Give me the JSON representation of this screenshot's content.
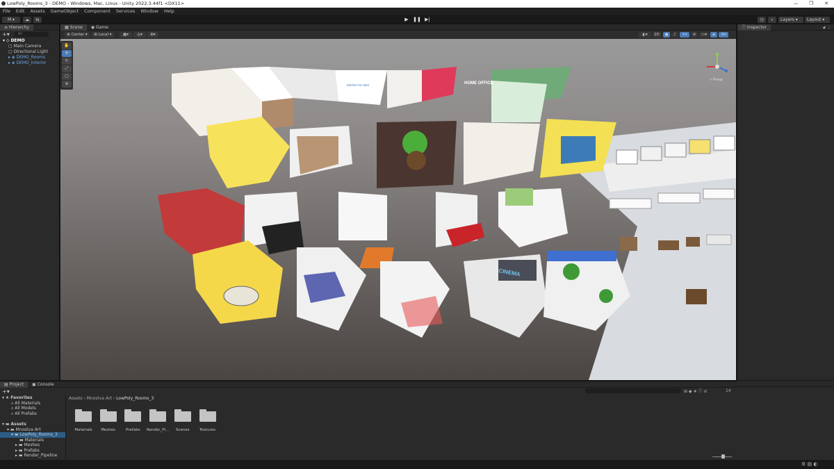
{
  "window": {
    "title": "LowPoly_Rooms_3 - DEMO - Windows, Mac, Linux - Unity 2022.3.44f1 <DX11>",
    "minimize": "—",
    "maximize": "❐",
    "close": "✕"
  },
  "menu": [
    "File",
    "Edit",
    "Assets",
    "GameObject",
    "Component",
    "Services",
    "Window",
    "Help"
  ],
  "toolbar": {
    "account": "M ▾",
    "layers": "Layers",
    "layout": "Layout"
  },
  "hierarchy": {
    "tab": "Hierarchy",
    "search_placeholder": "All",
    "items": [
      {
        "label": "DEMO",
        "indent": 0,
        "color": "#ffffff"
      },
      {
        "label": "Main Camera",
        "indent": 1,
        "color": "#c8c8c8"
      },
      {
        "label": "Directional Light",
        "indent": 1,
        "color": "#c8c8c8"
      },
      {
        "label": "DEMO_Rooms",
        "indent": 1,
        "color": "#6fa8e8"
      },
      {
        "label": "DEMO_Interior",
        "indent": 1,
        "color": "#6fa8e8"
      }
    ]
  },
  "scene": {
    "tabs": [
      "Scene",
      "Game"
    ],
    "pivot": "Center",
    "space": "Local",
    "mode_2d": "2D",
    "persp_label": "< Persp"
  },
  "inspector": {
    "tab": "Inspector"
  },
  "project": {
    "tabs": [
      "Project",
      "Console"
    ],
    "breadcrumb": [
      "Assets",
      "Mnostva Art",
      "LowPoly_Rooms_3"
    ],
    "count": "14",
    "favorites": {
      "label": "Favorites",
      "items": [
        "All Materials",
        "All Models",
        "All Prefabs"
      ]
    },
    "assets": {
      "label": "Assets",
      "children": [
        "Mnostva Art",
        "LowPoly_Rooms_3",
        "Materials",
        "Meshes",
        "Prefabs",
        "Render_Pipeline"
      ]
    },
    "folders": [
      "Materials",
      "Meshes",
      "Prefabs",
      "Render_Pi...",
      "Scenes",
      "Textures"
    ]
  },
  "room_labels": {
    "office": "HOME OFFICE",
    "cinema": "CINEMA",
    "kitchen_sign": "Kitchen for Ham"
  },
  "colors": {
    "accent": "#6fa8e8",
    "ground": "#4a4542",
    "sky": "#3c3c3c"
  }
}
